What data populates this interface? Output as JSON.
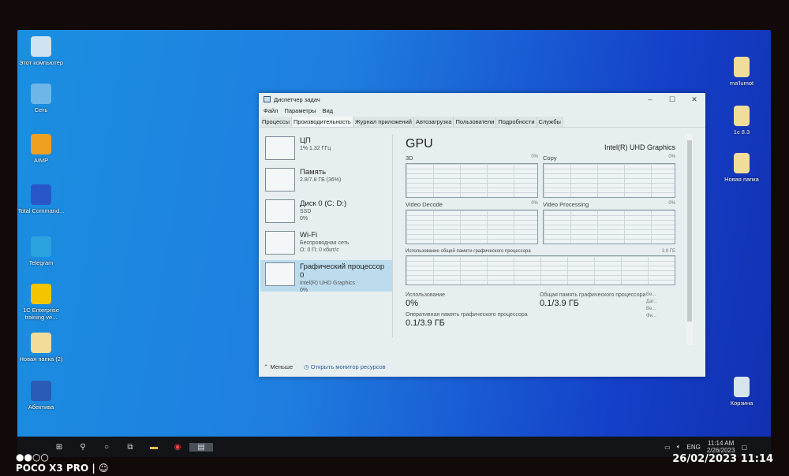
{
  "desktop": {
    "left_icons": [
      {
        "label": "Этот компьютер",
        "color": "#cfe3f3"
      },
      {
        "label": "Сеть",
        "color": "#6fb6e8"
      },
      {
        "label": "AIMP",
        "color": "#f0a020"
      },
      {
        "label": "Total Command...",
        "color": "#2a57c8"
      },
      {
        "label": "Telegram",
        "color": "#2aa3de"
      },
      {
        "label": "1C Enterprise training ve...",
        "color": "#f5c400"
      },
      {
        "label": "Новая папка (2)",
        "color": "#f1dc9a"
      },
      {
        "label": "Абектива",
        "color": "#2b5bb5"
      }
    ],
    "right_icons": [
      {
        "label": "ma'lumot",
        "color": "#f1dc9a"
      },
      {
        "label": "1c 8.3",
        "color": "#f1dc9a"
      },
      {
        "label": "Новая папка",
        "color": "#f1dc9a"
      },
      {
        "label": "Корзина",
        "color": "#d8e4ec"
      }
    ]
  },
  "window": {
    "title": "Диспетчер задач",
    "menu": [
      "Файл",
      "Параметры",
      "Вид"
    ],
    "tabs": [
      "Процессы",
      "Производительность",
      "Журнал приложений",
      "Автозагрузка",
      "Пользователи",
      "Подробности",
      "Службы"
    ],
    "active_tab": 1,
    "sidebar": [
      {
        "title": "ЦП",
        "sub1": "1% 1.32 ГГц",
        "sub2": ""
      },
      {
        "title": "Память",
        "sub1": "2.8/7.8 ГБ (36%)",
        "sub2": ""
      },
      {
        "title": "Диск 0 (C: D:)",
        "sub1": "SSD",
        "sub2": "0%"
      },
      {
        "title": "Wi-Fi",
        "sub1": "Беспроводная сеть",
        "sub2": "О: 0 П: 0 кбит/с"
      },
      {
        "title": "Графический процессор 0",
        "sub1": "Intel(R) UHD Graphics",
        "sub2": "0%"
      }
    ],
    "gpu": {
      "title": "GPU",
      "model": "Intel(R) UHD Graphics",
      "engines": [
        {
          "name": "3D",
          "pct": "0%"
        },
        {
          "name": "Copy",
          "pct": "0%"
        },
        {
          "name": "Video Decode",
          "pct": "0%"
        },
        {
          "name": "Video Processing",
          "pct": "0%"
        }
      ],
      "shared_label": "Использование общей памяти графического процессора",
      "shared_max": "3.9 ГБ",
      "usage_label": "Использование",
      "usage_value": "0%",
      "shared_mem_label": "Общая память графического процессора",
      "shared_mem_value": "0.1/3.9 ГБ",
      "dedicated_label": "Оперативная память графического процессора",
      "dedicated_value": "0.1/3.9 ГБ",
      "side_keys": [
        "Ве...",
        "Дат...",
        "Ве...",
        "Фи..."
      ]
    },
    "footer": {
      "less": "Меньше",
      "monitor": "Открыть монитор ресурсов"
    }
  },
  "taskbar": {
    "lang": "ENG",
    "time": "11:14 AM",
    "date": "2/26/2023"
  },
  "photo": {
    "watermark": "POCO X3 PRO |",
    "stamp": "26/02/2023  11:14"
  }
}
